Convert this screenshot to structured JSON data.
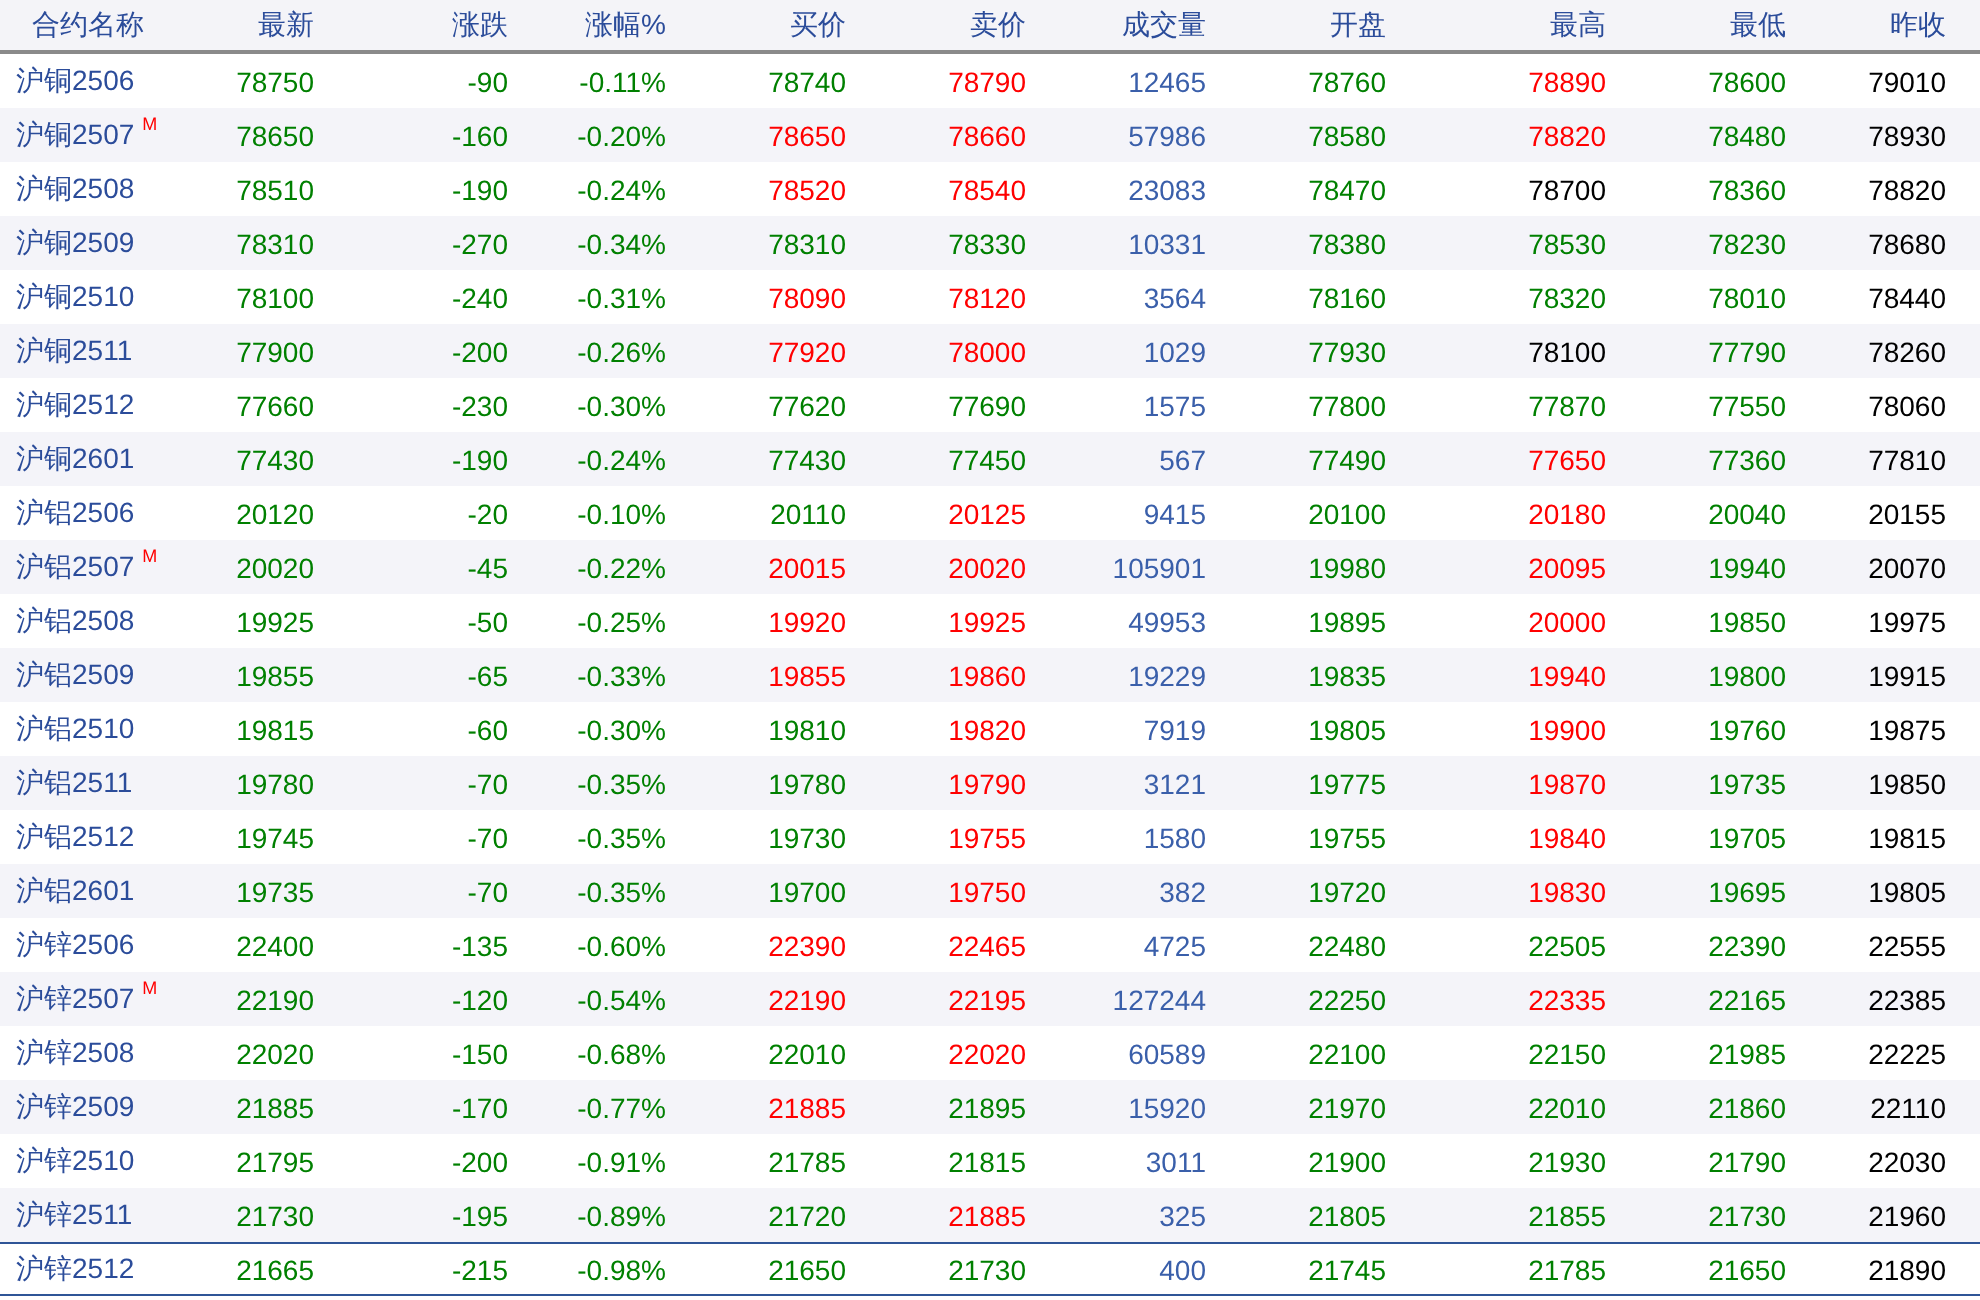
{
  "table": {
    "columns": [
      "合约名称",
      "最新",
      "涨跌",
      "涨幅%",
      "买价",
      "卖价",
      "成交量",
      "开盘",
      "最高",
      "最低",
      "昨收"
    ],
    "rows": [
      {
        "selected": false,
        "cells": [
          {
            "text": "沪铜2506"
          },
          {
            "text": "78750",
            "color": "#008000"
          },
          {
            "text": "-90",
            "color": "#008000"
          },
          {
            "text": "-0.11%",
            "color": "#008000"
          },
          {
            "text": "78740",
            "color": "#008000"
          },
          {
            "text": "78790",
            "color": "#ff0000"
          },
          {
            "text": "12465",
            "color": "#3a5faa"
          },
          {
            "text": "78760",
            "color": "#008000"
          },
          {
            "text": "78890",
            "color": "#ff0000"
          },
          {
            "text": "78600",
            "color": "#008000"
          },
          {
            "text": "79010",
            "color": "#000000"
          }
        ]
      },
      {
        "selected": false,
        "cells": [
          {
            "text": "沪铜2507",
            "mark": "M"
          },
          {
            "text": "78650",
            "color": "#008000"
          },
          {
            "text": "-160",
            "color": "#008000"
          },
          {
            "text": "-0.20%",
            "color": "#008000"
          },
          {
            "text": "78650",
            "color": "#ff0000"
          },
          {
            "text": "78660",
            "color": "#ff0000"
          },
          {
            "text": "57986",
            "color": "#3a5faa"
          },
          {
            "text": "78580",
            "color": "#008000"
          },
          {
            "text": "78820",
            "color": "#ff0000"
          },
          {
            "text": "78480",
            "color": "#008000"
          },
          {
            "text": "78930",
            "color": "#000000"
          }
        ]
      },
      {
        "selected": false,
        "cells": [
          {
            "text": "沪铜2508"
          },
          {
            "text": "78510",
            "color": "#008000"
          },
          {
            "text": "-190",
            "color": "#008000"
          },
          {
            "text": "-0.24%",
            "color": "#008000"
          },
          {
            "text": "78520",
            "color": "#ff0000"
          },
          {
            "text": "78540",
            "color": "#ff0000"
          },
          {
            "text": "23083",
            "color": "#3a5faa"
          },
          {
            "text": "78470",
            "color": "#008000"
          },
          {
            "text": "78700",
            "color": "#000000"
          },
          {
            "text": "78360",
            "color": "#008000"
          },
          {
            "text": "78820",
            "color": "#000000"
          }
        ]
      },
      {
        "selected": false,
        "cells": [
          {
            "text": "沪铜2509"
          },
          {
            "text": "78310",
            "color": "#008000"
          },
          {
            "text": "-270",
            "color": "#008000"
          },
          {
            "text": "-0.34%",
            "color": "#008000"
          },
          {
            "text": "78310",
            "color": "#008000"
          },
          {
            "text": "78330",
            "color": "#008000"
          },
          {
            "text": "10331",
            "color": "#3a5faa"
          },
          {
            "text": "78380",
            "color": "#008000"
          },
          {
            "text": "78530",
            "color": "#008000"
          },
          {
            "text": "78230",
            "color": "#008000"
          },
          {
            "text": "78680",
            "color": "#000000"
          }
        ]
      },
      {
        "selected": false,
        "cells": [
          {
            "text": "沪铜2510"
          },
          {
            "text": "78100",
            "color": "#008000"
          },
          {
            "text": "-240",
            "color": "#008000"
          },
          {
            "text": "-0.31%",
            "color": "#008000"
          },
          {
            "text": "78090",
            "color": "#ff0000"
          },
          {
            "text": "78120",
            "color": "#ff0000"
          },
          {
            "text": "3564",
            "color": "#3a5faa"
          },
          {
            "text": "78160",
            "color": "#008000"
          },
          {
            "text": "78320",
            "color": "#008000"
          },
          {
            "text": "78010",
            "color": "#008000"
          },
          {
            "text": "78440",
            "color": "#000000"
          }
        ]
      },
      {
        "selected": false,
        "cells": [
          {
            "text": "沪铜2511"
          },
          {
            "text": "77900",
            "color": "#008000"
          },
          {
            "text": "-200",
            "color": "#008000"
          },
          {
            "text": "-0.26%",
            "color": "#008000"
          },
          {
            "text": "77920",
            "color": "#ff0000"
          },
          {
            "text": "78000",
            "color": "#ff0000"
          },
          {
            "text": "1029",
            "color": "#3a5faa"
          },
          {
            "text": "77930",
            "color": "#008000"
          },
          {
            "text": "78100",
            "color": "#000000"
          },
          {
            "text": "77790",
            "color": "#008000"
          },
          {
            "text": "78260",
            "color": "#000000"
          }
        ]
      },
      {
        "selected": false,
        "cells": [
          {
            "text": "沪铜2512"
          },
          {
            "text": "77660",
            "color": "#008000"
          },
          {
            "text": "-230",
            "color": "#008000"
          },
          {
            "text": "-0.30%",
            "color": "#008000"
          },
          {
            "text": "77620",
            "color": "#008000"
          },
          {
            "text": "77690",
            "color": "#008000"
          },
          {
            "text": "1575",
            "color": "#3a5faa"
          },
          {
            "text": "77800",
            "color": "#008000"
          },
          {
            "text": "77870",
            "color": "#008000"
          },
          {
            "text": "77550",
            "color": "#008000"
          },
          {
            "text": "78060",
            "color": "#000000"
          }
        ]
      },
      {
        "selected": false,
        "cells": [
          {
            "text": "沪铜2601"
          },
          {
            "text": "77430",
            "color": "#008000"
          },
          {
            "text": "-190",
            "color": "#008000"
          },
          {
            "text": "-0.24%",
            "color": "#008000"
          },
          {
            "text": "77430",
            "color": "#008000"
          },
          {
            "text": "77450",
            "color": "#008000"
          },
          {
            "text": "567",
            "color": "#3a5faa"
          },
          {
            "text": "77490",
            "color": "#008000"
          },
          {
            "text": "77650",
            "color": "#ff0000"
          },
          {
            "text": "77360",
            "color": "#008000"
          },
          {
            "text": "77810",
            "color": "#000000"
          }
        ]
      },
      {
        "selected": false,
        "cells": [
          {
            "text": "沪铝2506"
          },
          {
            "text": "20120",
            "color": "#008000"
          },
          {
            "text": "-20",
            "color": "#008000"
          },
          {
            "text": "-0.10%",
            "color": "#008000"
          },
          {
            "text": "20110",
            "color": "#008000"
          },
          {
            "text": "20125",
            "color": "#ff0000"
          },
          {
            "text": "9415",
            "color": "#3a5faa"
          },
          {
            "text": "20100",
            "color": "#008000"
          },
          {
            "text": "20180",
            "color": "#ff0000"
          },
          {
            "text": "20040",
            "color": "#008000"
          },
          {
            "text": "20155",
            "color": "#000000"
          }
        ]
      },
      {
        "selected": false,
        "cells": [
          {
            "text": "沪铝2507",
            "mark": "M"
          },
          {
            "text": "20020",
            "color": "#008000"
          },
          {
            "text": "-45",
            "color": "#008000"
          },
          {
            "text": "-0.22%",
            "color": "#008000"
          },
          {
            "text": "20015",
            "color": "#ff0000"
          },
          {
            "text": "20020",
            "color": "#ff0000"
          },
          {
            "text": "105901",
            "color": "#3a5faa"
          },
          {
            "text": "19980",
            "color": "#008000"
          },
          {
            "text": "20095",
            "color": "#ff0000"
          },
          {
            "text": "19940",
            "color": "#008000"
          },
          {
            "text": "20070",
            "color": "#000000"
          }
        ]
      },
      {
        "selected": false,
        "cells": [
          {
            "text": "沪铝2508"
          },
          {
            "text": "19925",
            "color": "#008000"
          },
          {
            "text": "-50",
            "color": "#008000"
          },
          {
            "text": "-0.25%",
            "color": "#008000"
          },
          {
            "text": "19920",
            "color": "#ff0000"
          },
          {
            "text": "19925",
            "color": "#ff0000"
          },
          {
            "text": "49953",
            "color": "#3a5faa"
          },
          {
            "text": "19895",
            "color": "#008000"
          },
          {
            "text": "20000",
            "color": "#ff0000"
          },
          {
            "text": "19850",
            "color": "#008000"
          },
          {
            "text": "19975",
            "color": "#000000"
          }
        ]
      },
      {
        "selected": false,
        "cells": [
          {
            "text": "沪铝2509"
          },
          {
            "text": "19855",
            "color": "#008000"
          },
          {
            "text": "-65",
            "color": "#008000"
          },
          {
            "text": "-0.33%",
            "color": "#008000"
          },
          {
            "text": "19855",
            "color": "#ff0000"
          },
          {
            "text": "19860",
            "color": "#ff0000"
          },
          {
            "text": "19229",
            "color": "#3a5faa"
          },
          {
            "text": "19835",
            "color": "#008000"
          },
          {
            "text": "19940",
            "color": "#ff0000"
          },
          {
            "text": "19800",
            "color": "#008000"
          },
          {
            "text": "19915",
            "color": "#000000"
          }
        ]
      },
      {
        "selected": false,
        "cells": [
          {
            "text": "沪铝2510"
          },
          {
            "text": "19815",
            "color": "#008000"
          },
          {
            "text": "-60",
            "color": "#008000"
          },
          {
            "text": "-0.30%",
            "color": "#008000"
          },
          {
            "text": "19810",
            "color": "#008000"
          },
          {
            "text": "19820",
            "color": "#ff0000"
          },
          {
            "text": "7919",
            "color": "#3a5faa"
          },
          {
            "text": "19805",
            "color": "#008000"
          },
          {
            "text": "19900",
            "color": "#ff0000"
          },
          {
            "text": "19760",
            "color": "#008000"
          },
          {
            "text": "19875",
            "color": "#000000"
          }
        ]
      },
      {
        "selected": false,
        "cells": [
          {
            "text": "沪铝2511"
          },
          {
            "text": "19780",
            "color": "#008000"
          },
          {
            "text": "-70",
            "color": "#008000"
          },
          {
            "text": "-0.35%",
            "color": "#008000"
          },
          {
            "text": "19780",
            "color": "#008000"
          },
          {
            "text": "19790",
            "color": "#ff0000"
          },
          {
            "text": "3121",
            "color": "#3a5faa"
          },
          {
            "text": "19775",
            "color": "#008000"
          },
          {
            "text": "19870",
            "color": "#ff0000"
          },
          {
            "text": "19735",
            "color": "#008000"
          },
          {
            "text": "19850",
            "color": "#000000"
          }
        ]
      },
      {
        "selected": false,
        "cells": [
          {
            "text": "沪铝2512"
          },
          {
            "text": "19745",
            "color": "#008000"
          },
          {
            "text": "-70",
            "color": "#008000"
          },
          {
            "text": "-0.35%",
            "color": "#008000"
          },
          {
            "text": "19730",
            "color": "#008000"
          },
          {
            "text": "19755",
            "color": "#ff0000"
          },
          {
            "text": "1580",
            "color": "#3a5faa"
          },
          {
            "text": "19755",
            "color": "#008000"
          },
          {
            "text": "19840",
            "color": "#ff0000"
          },
          {
            "text": "19705",
            "color": "#008000"
          },
          {
            "text": "19815",
            "color": "#000000"
          }
        ]
      },
      {
        "selected": false,
        "cells": [
          {
            "text": "沪铝2601"
          },
          {
            "text": "19735",
            "color": "#008000"
          },
          {
            "text": "-70",
            "color": "#008000"
          },
          {
            "text": "-0.35%",
            "color": "#008000"
          },
          {
            "text": "19700",
            "color": "#008000"
          },
          {
            "text": "19750",
            "color": "#ff0000"
          },
          {
            "text": "382",
            "color": "#3a5faa"
          },
          {
            "text": "19720",
            "color": "#008000"
          },
          {
            "text": "19830",
            "color": "#ff0000"
          },
          {
            "text": "19695",
            "color": "#008000"
          },
          {
            "text": "19805",
            "color": "#000000"
          }
        ]
      },
      {
        "selected": false,
        "cells": [
          {
            "text": "沪锌2506"
          },
          {
            "text": "22400",
            "color": "#008000"
          },
          {
            "text": "-135",
            "color": "#008000"
          },
          {
            "text": "-0.60%",
            "color": "#008000"
          },
          {
            "text": "22390",
            "color": "#ff0000"
          },
          {
            "text": "22465",
            "color": "#ff0000"
          },
          {
            "text": "4725",
            "color": "#3a5faa"
          },
          {
            "text": "22480",
            "color": "#008000"
          },
          {
            "text": "22505",
            "color": "#008000"
          },
          {
            "text": "22390",
            "color": "#008000"
          },
          {
            "text": "22555",
            "color": "#000000"
          }
        ]
      },
      {
        "selected": false,
        "cells": [
          {
            "text": "沪锌2507",
            "mark": "M"
          },
          {
            "text": "22190",
            "color": "#008000"
          },
          {
            "text": "-120",
            "color": "#008000"
          },
          {
            "text": "-0.54%",
            "color": "#008000"
          },
          {
            "text": "22190",
            "color": "#ff0000"
          },
          {
            "text": "22195",
            "color": "#ff0000"
          },
          {
            "text": "127244",
            "color": "#3a5faa"
          },
          {
            "text": "22250",
            "color": "#008000"
          },
          {
            "text": "22335",
            "color": "#ff0000"
          },
          {
            "text": "22165",
            "color": "#008000"
          },
          {
            "text": "22385",
            "color": "#000000"
          }
        ]
      },
      {
        "selected": false,
        "cells": [
          {
            "text": "沪锌2508"
          },
          {
            "text": "22020",
            "color": "#008000"
          },
          {
            "text": "-150",
            "color": "#008000"
          },
          {
            "text": "-0.68%",
            "color": "#008000"
          },
          {
            "text": "22010",
            "color": "#008000"
          },
          {
            "text": "22020",
            "color": "#ff0000"
          },
          {
            "text": "60589",
            "color": "#3a5faa"
          },
          {
            "text": "22100",
            "color": "#008000"
          },
          {
            "text": "22150",
            "color": "#008000"
          },
          {
            "text": "21985",
            "color": "#008000"
          },
          {
            "text": "22225",
            "color": "#000000"
          }
        ]
      },
      {
        "selected": false,
        "cells": [
          {
            "text": "沪锌2509"
          },
          {
            "text": "21885",
            "color": "#008000"
          },
          {
            "text": "-170",
            "color": "#008000"
          },
          {
            "text": "-0.77%",
            "color": "#008000"
          },
          {
            "text": "21885",
            "color": "#ff0000"
          },
          {
            "text": "21895",
            "color": "#008000"
          },
          {
            "text": "15920",
            "color": "#3a5faa"
          },
          {
            "text": "21970",
            "color": "#008000"
          },
          {
            "text": "22010",
            "color": "#008000"
          },
          {
            "text": "21860",
            "color": "#008000"
          },
          {
            "text": "22110",
            "color": "#000000"
          }
        ]
      },
      {
        "selected": false,
        "cells": [
          {
            "text": "沪锌2510"
          },
          {
            "text": "21795",
            "color": "#008000"
          },
          {
            "text": "-200",
            "color": "#008000"
          },
          {
            "text": "-0.91%",
            "color": "#008000"
          },
          {
            "text": "21785",
            "color": "#008000"
          },
          {
            "text": "21815",
            "color": "#008000"
          },
          {
            "text": "3011",
            "color": "#3a5faa"
          },
          {
            "text": "21900",
            "color": "#008000"
          },
          {
            "text": "21930",
            "color": "#008000"
          },
          {
            "text": "21790",
            "color": "#008000"
          },
          {
            "text": "22030",
            "color": "#000000"
          }
        ]
      },
      {
        "selected": false,
        "cells": [
          {
            "text": "沪锌2511"
          },
          {
            "text": "21730",
            "color": "#008000"
          },
          {
            "text": "-195",
            "color": "#008000"
          },
          {
            "text": "-0.89%",
            "color": "#008000"
          },
          {
            "text": "21720",
            "color": "#008000"
          },
          {
            "text": "21885",
            "color": "#ff0000"
          },
          {
            "text": "325",
            "color": "#3a5faa"
          },
          {
            "text": "21805",
            "color": "#008000"
          },
          {
            "text": "21855",
            "color": "#008000"
          },
          {
            "text": "21730",
            "color": "#008000"
          },
          {
            "text": "21960",
            "color": "#000000"
          }
        ]
      },
      {
        "selected": true,
        "cells": [
          {
            "text": "沪锌2512"
          },
          {
            "text": "21665",
            "color": "#008000"
          },
          {
            "text": "-215",
            "color": "#008000"
          },
          {
            "text": "-0.98%",
            "color": "#008000"
          },
          {
            "text": "21650",
            "color": "#008000"
          },
          {
            "text": "21730",
            "color": "#008000"
          },
          {
            "text": "400",
            "color": "#3a5faa"
          },
          {
            "text": "21745",
            "color": "#008000"
          },
          {
            "text": "21785",
            "color": "#008000"
          },
          {
            "text": "21650",
            "color": "#008000"
          },
          {
            "text": "21890",
            "color": "#000000"
          }
        ]
      }
    ]
  }
}
